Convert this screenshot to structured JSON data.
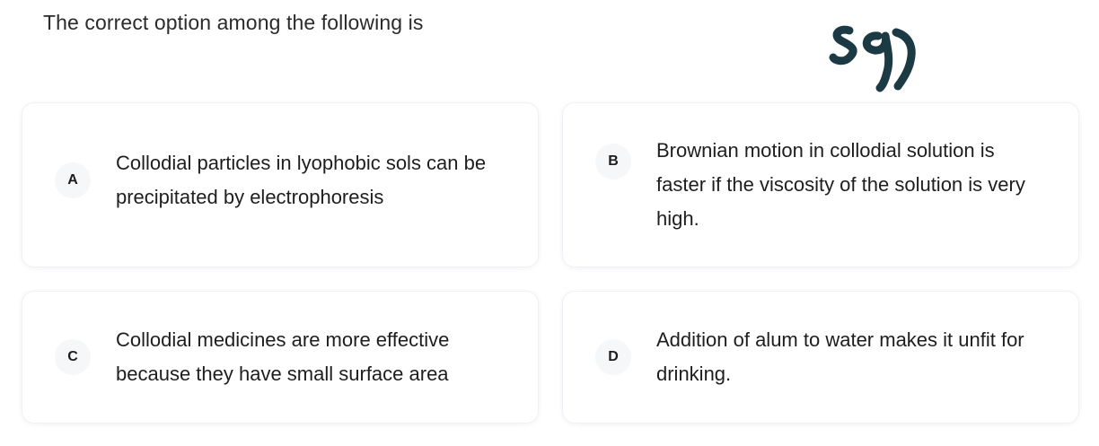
{
  "question": {
    "text": "The correct option among the following is"
  },
  "signature": {
    "icon": "handwritten-signature",
    "color": "#1b3a44"
  },
  "options": [
    {
      "letter": "A",
      "text": "Collodial particles in lyophobic sols can be precipitated by electrophoresis"
    },
    {
      "letter": "B",
      "text": "Brownian motion in collodial solution is faster if the viscosity of the solution is very high."
    },
    {
      "letter": "C",
      "text": "Collodial medicines are more effective because they have small surface area"
    },
    {
      "letter": "D",
      "text": "Addition of alum to water makes it unfit for drinking."
    }
  ]
}
